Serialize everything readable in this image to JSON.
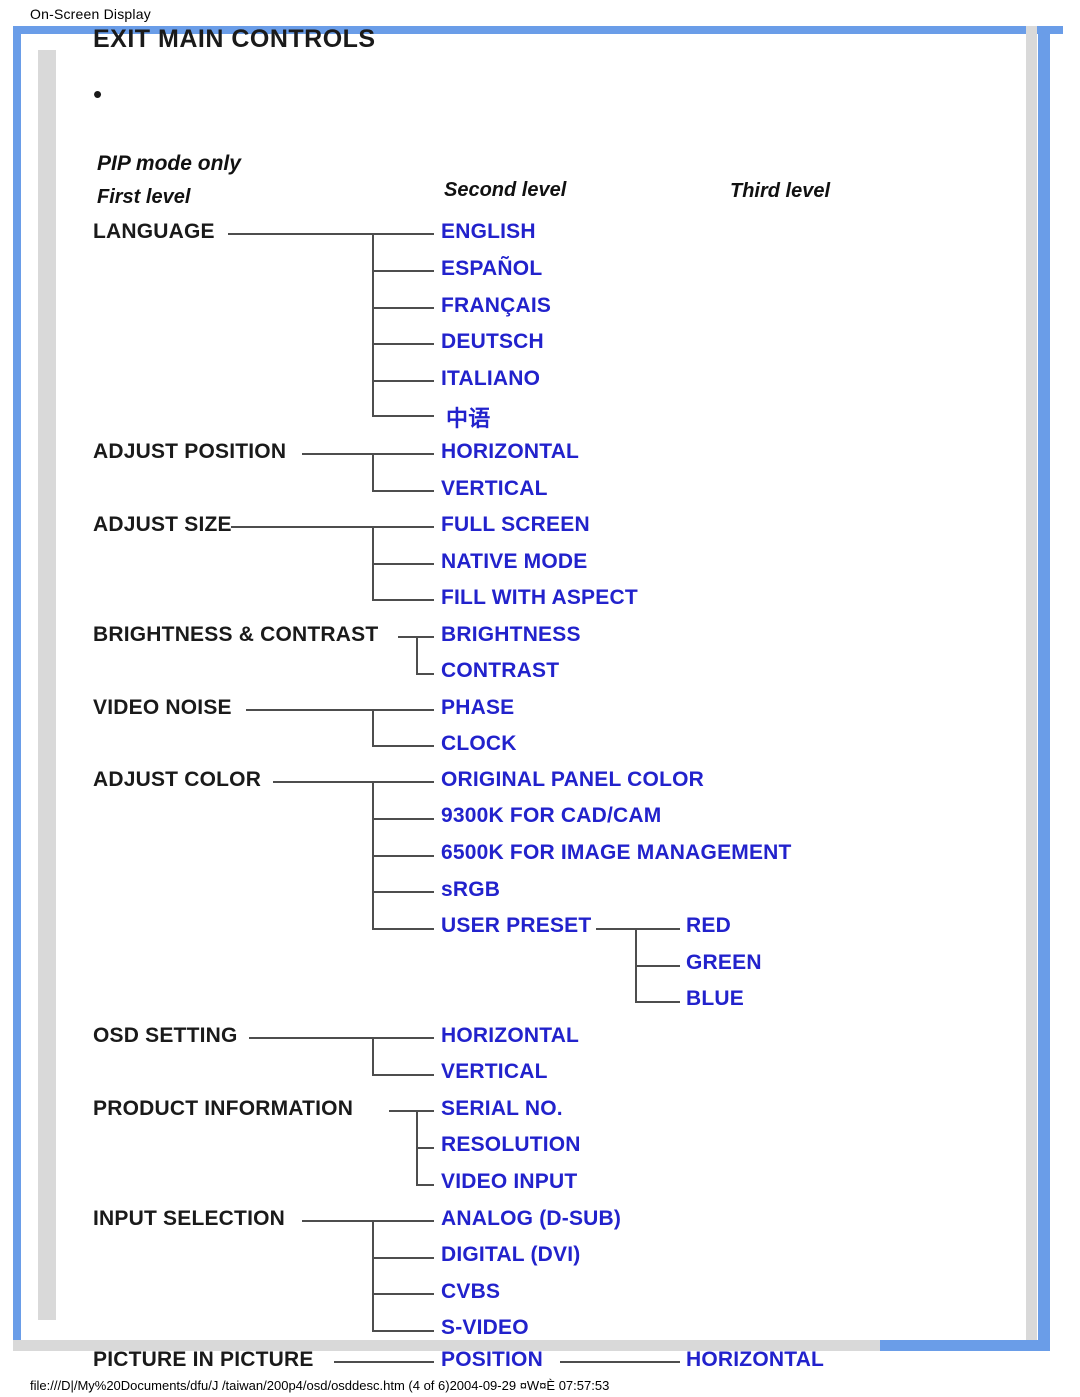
{
  "header": {
    "title": "On-Screen Display"
  },
  "footer": {
    "path": "file:///D|/My%20Documents/dfu/J /taiwan/200p4/osd/osddesc.htm (4 of 6)2004-09-29 ¤W¤È 07:57:53"
  },
  "page": {
    "exit_title": "EXIT MAIN CONTROLS",
    "bullet": "•",
    "pip_note": "PIP mode only",
    "columns": {
      "first": "First level",
      "second": "Second level",
      "third": "Third level"
    }
  },
  "menu": {
    "language": {
      "label": "LANGUAGE",
      "children": [
        "ENGLISH",
        "ESPAÑOL",
        "FRANÇAIS",
        "DEUTSCH",
        "ITALIANO",
        "中语"
      ]
    },
    "adjust_position": {
      "label": "ADJUST POSITION",
      "children": [
        "HORIZONTAL",
        "VERTICAL"
      ]
    },
    "adjust_size": {
      "label": "ADJUST SIZE",
      "children": [
        "FULL SCREEN",
        "NATIVE MODE",
        "FILL WITH ASPECT"
      ]
    },
    "brightness_contrast": {
      "label": "BRIGHTNESS & CONTRAST",
      "children": [
        "BRIGHTNESS",
        "CONTRAST"
      ]
    },
    "video_noise": {
      "label": "VIDEO NOISE",
      "children": [
        "PHASE",
        "CLOCK"
      ]
    },
    "adjust_color": {
      "label": "ADJUST COLOR",
      "children": [
        "ORIGINAL PANEL COLOR",
        "9300K FOR CAD/CAM",
        "6500K FOR IMAGE MANAGEMENT",
        "sRGB",
        "USER PRESET"
      ],
      "user_preset_children": [
        "RED",
        "GREEN",
        "BLUE"
      ]
    },
    "osd_setting": {
      "label": "OSD SETTING",
      "children": [
        "HORIZONTAL",
        "VERTICAL"
      ]
    },
    "product_information": {
      "label": "PRODUCT INFORMATION",
      "children": [
        "SERIAL NO.",
        "RESOLUTION",
        "VIDEO INPUT"
      ]
    },
    "input_selection": {
      "label": "INPUT SELECTION",
      "children": [
        "ANALOG (D-SUB)",
        "DIGITAL (DVI)",
        "CVBS",
        "S-VIDEO"
      ]
    },
    "picture_in_picture": {
      "label": "PICTURE IN PICTURE",
      "children": [
        "POSITION"
      ],
      "position_children": [
        "HORIZONTAL"
      ]
    }
  },
  "colors": {
    "frame_blue": "#6a9de8",
    "link_blue": "#2222cc",
    "line_gray": "#4d4d4d"
  }
}
